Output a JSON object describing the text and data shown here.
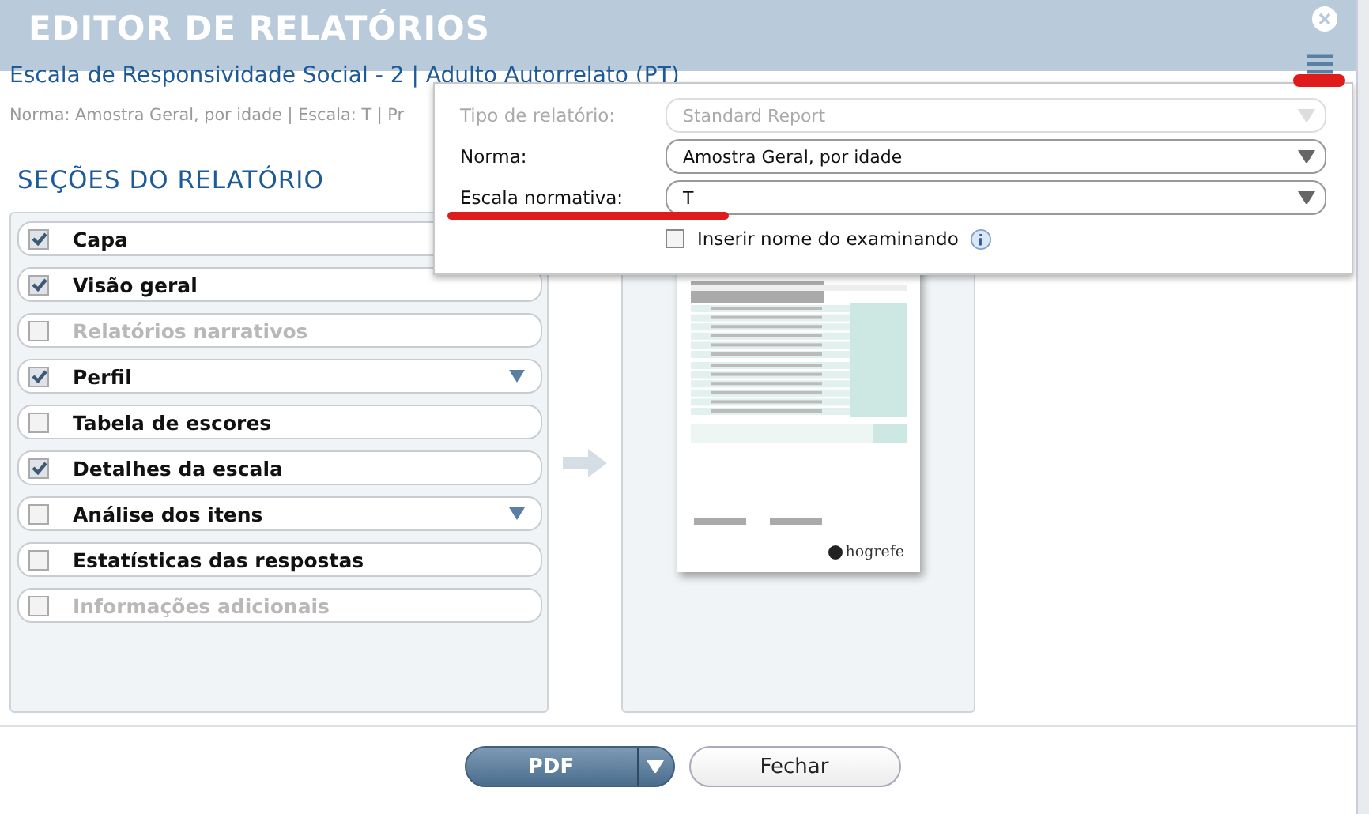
{
  "dialog": {
    "title": "EDITOR DE RELATÓRIOS",
    "subtitle": "Escala de Responsividade Social - 2 | Adulto Autorrelato (PT)",
    "info_line": "Norma: Amostra Geral, por idade | Escala: T | Pr"
  },
  "sections_heading": "SEÇÕES DO RELATÓRIO",
  "sections": [
    {
      "label": "Capa",
      "checked": true,
      "disabled": false,
      "expandable": false
    },
    {
      "label": "Visão geral",
      "checked": true,
      "disabled": false,
      "expandable": false
    },
    {
      "label": "Relatórios narrativos",
      "checked": false,
      "disabled": true,
      "expandable": false
    },
    {
      "label": "Perfil",
      "checked": true,
      "disabled": false,
      "expandable": true
    },
    {
      "label": "Tabela de escores",
      "checked": false,
      "disabled": false,
      "expandable": false
    },
    {
      "label": "Detalhes da escala",
      "checked": true,
      "disabled": false,
      "expandable": false
    },
    {
      "label": "Análise dos itens",
      "checked": false,
      "disabled": false,
      "expandable": true
    },
    {
      "label": "Estatísticas das respostas",
      "checked": false,
      "disabled": false,
      "expandable": false
    },
    {
      "label": "Informações adicionais",
      "checked": false,
      "disabled": true,
      "expandable": false
    }
  ],
  "preview": {
    "logo_text": "hogrefe"
  },
  "settings_popup": {
    "fields": [
      {
        "label": "Tipo de relatório:",
        "value": "Standard Report",
        "disabled": true
      },
      {
        "label": "Norma:",
        "value": "Amostra Geral, por idade",
        "disabled": false
      },
      {
        "label": "Escala normativa:",
        "value": "T",
        "disabled": false
      }
    ],
    "insert_name": {
      "label": "Inserir nome do examinando",
      "checked": false
    }
  },
  "buttons": {
    "pdf": "PDF",
    "close": "Fechar"
  }
}
